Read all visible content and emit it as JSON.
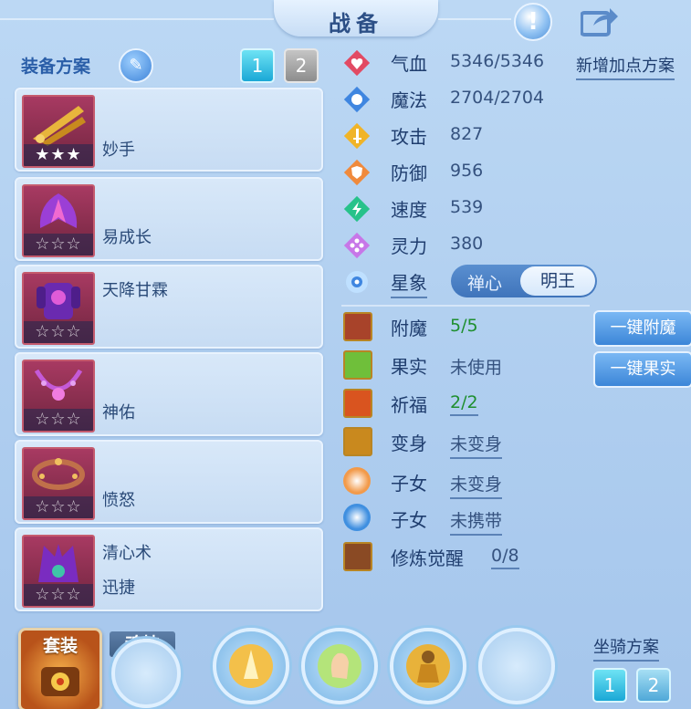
{
  "header": {
    "title": "战备",
    "help_label": "!"
  },
  "equipment_section": {
    "label": "装备方案",
    "plan_buttons": [
      "1",
      "2"
    ],
    "items": [
      {
        "name": "妙手",
        "stars": "★★★",
        "star_state": "filled",
        "name2": ""
      },
      {
        "name": "易成长",
        "stars": "☆☆☆",
        "star_state": "empty",
        "name2": ""
      },
      {
        "name": "天降甘霖",
        "stars": "☆☆☆",
        "star_state": "empty",
        "name2": ""
      },
      {
        "name": "神佑",
        "stars": "☆☆☆",
        "star_state": "empty",
        "name2": ""
      },
      {
        "name": "愤怒",
        "stars": "☆☆☆",
        "star_state": "empty",
        "name2": ""
      },
      {
        "name": "清心术",
        "stars": "☆☆☆",
        "star_state": "empty",
        "name2": "迅捷"
      }
    ]
  },
  "stats": {
    "new_plan_label": "新增加点方案",
    "rows": [
      {
        "name": "气血",
        "value": "5346/5346",
        "icon": "heart-icon",
        "color": "#e24a63"
      },
      {
        "name": "魔法",
        "value": "2704/2704",
        "icon": "mana-icon",
        "color": "#3f86e0"
      },
      {
        "name": "攻击",
        "value": "827",
        "icon": "sword-icon",
        "color": "#f0b428"
      },
      {
        "name": "防御",
        "value": "956",
        "icon": "shield-icon",
        "color": "#f08a3c"
      },
      {
        "name": "速度",
        "value": "539",
        "icon": "speed-icon",
        "color": "#27c28a"
      },
      {
        "name": "灵力",
        "value": "380",
        "icon": "spirit-icon",
        "color": "#c777e8"
      }
    ],
    "constellation": {
      "label": "星象",
      "options": [
        "禅心",
        "明王"
      ],
      "selected": "明王"
    }
  },
  "enhancements": {
    "rows": [
      {
        "name": "附魔",
        "value": "5/5",
        "icon": "enchant-icon",
        "style": "green"
      },
      {
        "name": "果实",
        "value": "未使用",
        "icon": "fruit-icon",
        "style": "plain"
      },
      {
        "name": "祈福",
        "value": "2/2",
        "icon": "blessing-icon",
        "style": "green-underline"
      },
      {
        "name": "变身",
        "value": "未变身",
        "icon": "transform-icon",
        "style": "underline"
      },
      {
        "name": "子女",
        "value": "未变身",
        "icon": "child-icon",
        "style": "underline"
      },
      {
        "name": "子女",
        "value": "未携带",
        "icon": "paw-icon",
        "style": "underline"
      },
      {
        "name": "修炼觉醒",
        "value": "0/8",
        "icon": "cultivation-icon",
        "style": "underline"
      }
    ],
    "buttons": {
      "enchant_all": "一键附魔",
      "fruit_all": "一键果实"
    }
  },
  "bottom": {
    "suit_label": "套装",
    "soul_skill_label": "魂技",
    "mount_plan_label": "坐骑方案",
    "mount_buttons": [
      "1",
      "2"
    ]
  },
  "colors": {
    "accent": "#2a5ea8",
    "active_tab": "#1aa8d6",
    "green_value": "#1f8f2f"
  }
}
